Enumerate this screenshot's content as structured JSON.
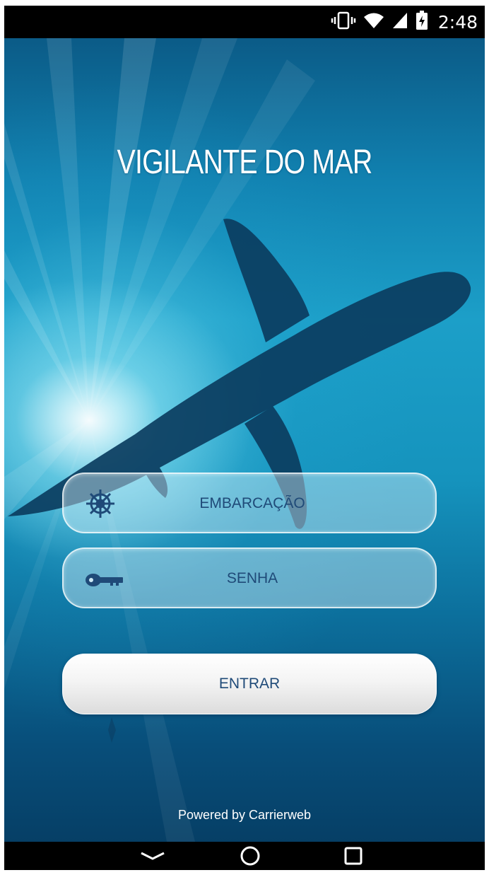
{
  "status_bar": {
    "time": "2:48",
    "icons": [
      "vibrate-icon",
      "wifi-icon",
      "signal-icon",
      "battery-charging-icon"
    ]
  },
  "app": {
    "title": "VIGILANTE DO MAR",
    "background": "underwater-shark-photo"
  },
  "form": {
    "vessel": {
      "placeholder": "EMBARCAÇÃO",
      "value": "",
      "icon": "ship-wheel-icon"
    },
    "password": {
      "placeholder": "SENHA",
      "value": "",
      "icon": "key-icon"
    },
    "submit_label": "ENTRAR"
  },
  "footer": {
    "powered_by": "Powered by Carrierweb"
  },
  "nav_bar": {
    "buttons": [
      "back-icon",
      "home-icon",
      "recents-icon"
    ]
  },
  "colors": {
    "text_primary": "#1f4a78",
    "ocean_light": "#1c9fc8",
    "ocean_dark": "#063f66",
    "white": "#ffffff"
  }
}
